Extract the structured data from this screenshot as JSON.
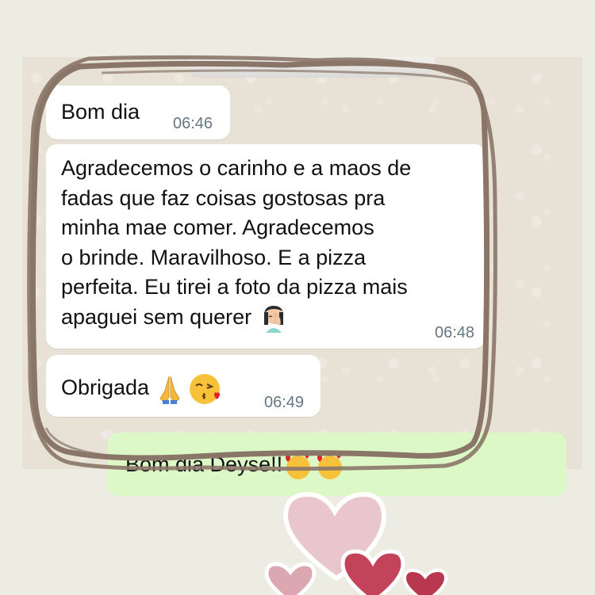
{
  "messages": [
    {
      "text": "Bom dia",
      "time": "06:46",
      "direction": "incoming"
    },
    {
      "text": "Agradecemos o carinho e a maos de\nfadas que faz coisas gostosas pra\nminha mae comer. Agradecemos\no brinde. Maravilhoso. E a pizza\nperfeita. Eu tirei a foto da pizza mais\napaguei sem querer",
      "time": "06:48",
      "direction": "incoming",
      "emoji": "facepalm-emoji"
    },
    {
      "text": "Obrigada",
      "time": "06:49",
      "direction": "incoming",
      "emojis": [
        "folded-hands-emoji",
        "kissing-face-emoji"
      ]
    },
    {
      "text": "Bom dia Deyse!!",
      "direction": "outgoing",
      "emojis": [
        "smiling-face-with-hearts-emoji",
        "smiling-face-with-hearts-emoji"
      ]
    }
  ],
  "colors": {
    "page_background": "#ecece2",
    "chat_background": "#e7e1d6",
    "incoming_bubble": "#ffffff",
    "outgoing_bubble": "#dcf8c6",
    "frame_stroke": "#8a7668",
    "heart_pink": "#e9c6cd",
    "heart_red": "#c2435a"
  }
}
